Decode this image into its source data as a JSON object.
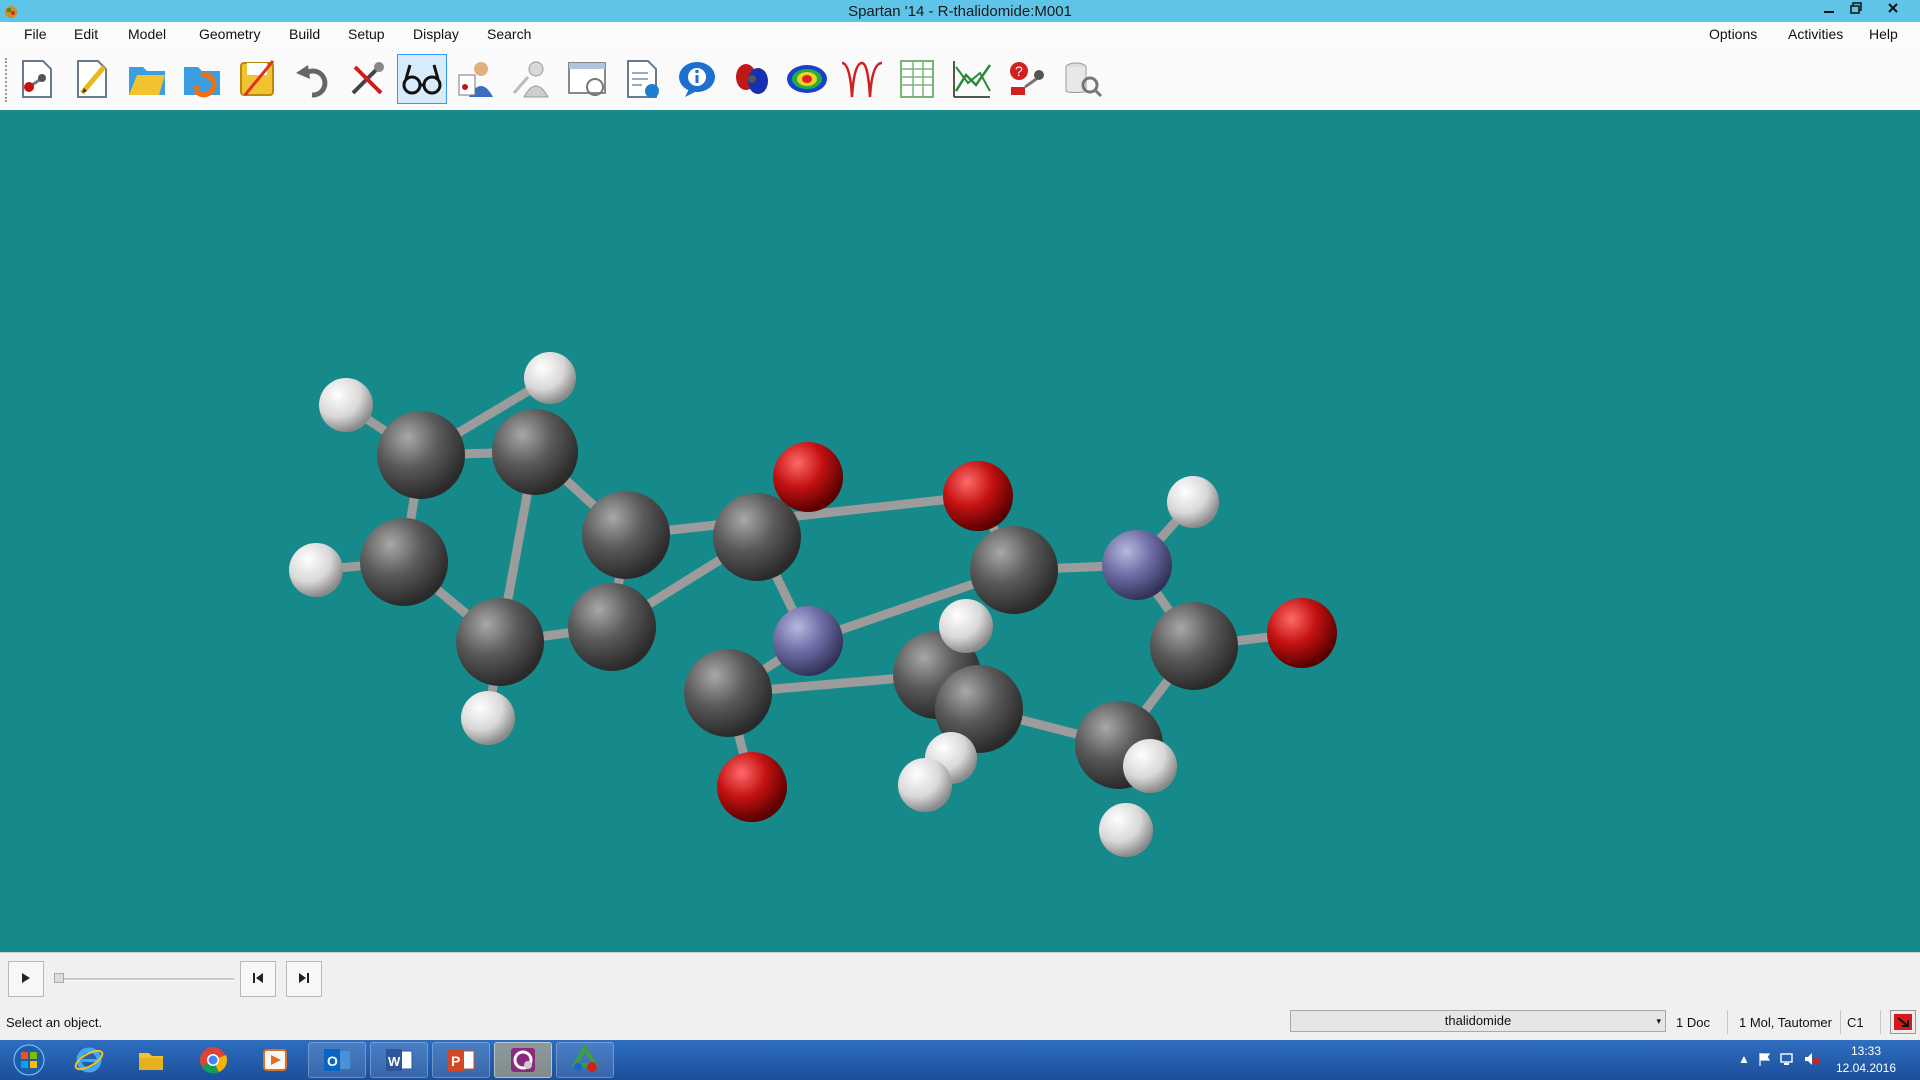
{
  "window": {
    "title": "Spartan '14 - R-thalidomide:M001",
    "app_icon": "spartan-app-icon",
    "controls": [
      "minimize",
      "restore",
      "close"
    ]
  },
  "menu": {
    "left": [
      "File",
      "Edit",
      "Model",
      "Geometry",
      "Build",
      "Setup",
      "Display",
      "Search"
    ],
    "right": [
      "Options",
      "Activities",
      "Help"
    ]
  },
  "toolbar": {
    "buttons": [
      {
        "icon": "new-build-icon"
      },
      {
        "icon": "new-sketch-icon"
      },
      {
        "icon": "open-folder-icon"
      },
      {
        "icon": "open-recent-icon"
      },
      {
        "icon": "save-icon"
      },
      {
        "icon": "undo-icon"
      },
      {
        "icon": "build-tools-icon"
      },
      {
        "icon": "view-glasses-icon",
        "active": true
      },
      {
        "icon": "calculations-icon"
      },
      {
        "icon": "monitor-icon"
      },
      {
        "icon": "surfaces-window-icon"
      },
      {
        "icon": "output-icon"
      },
      {
        "icon": "properties-info-icon"
      },
      {
        "icon": "orbitals-icon"
      },
      {
        "icon": "potential-map-icon"
      },
      {
        "icon": "spectra-icon"
      },
      {
        "icon": "spreadsheet-icon"
      },
      {
        "icon": "plots-icon"
      },
      {
        "icon": "reactions-icon"
      },
      {
        "icon": "database-search-icon"
      }
    ]
  },
  "molecule": {
    "name": "thalidomide",
    "colors": {
      "carbon": "#5c5c5c",
      "hydrogen": "#ebebeb",
      "oxygen": "#c41212",
      "nitrogen": "#6e6ea6",
      "bond": "#9a9a9a"
    },
    "background": "#168a8a"
  },
  "animation": {
    "play_icon": "play-icon",
    "step_back_icon": "step-back-icon",
    "step_forward_icon": "step-forward-icon",
    "position": 0
  },
  "status": {
    "message": "Select an object.",
    "molecule_selector": "thalidomide",
    "doc_count": "1 Doc",
    "mol_info": "1 Mol, Tautomer",
    "symmetry": "C1"
  },
  "taskbar": {
    "apps": [
      {
        "icon": "start-orb-icon"
      },
      {
        "icon": "internet-explorer-icon"
      },
      {
        "icon": "file-explorer-icon"
      },
      {
        "icon": "chrome-icon"
      },
      {
        "icon": "media-player-icon"
      },
      {
        "icon": "outlook-icon"
      },
      {
        "icon": "word-icon"
      },
      {
        "icon": "powerpoint-icon"
      },
      {
        "icon": "spartan-icon"
      },
      {
        "icon": "recycle-app-icon"
      }
    ],
    "time": "13:33",
    "date": "12.04.2016"
  }
}
